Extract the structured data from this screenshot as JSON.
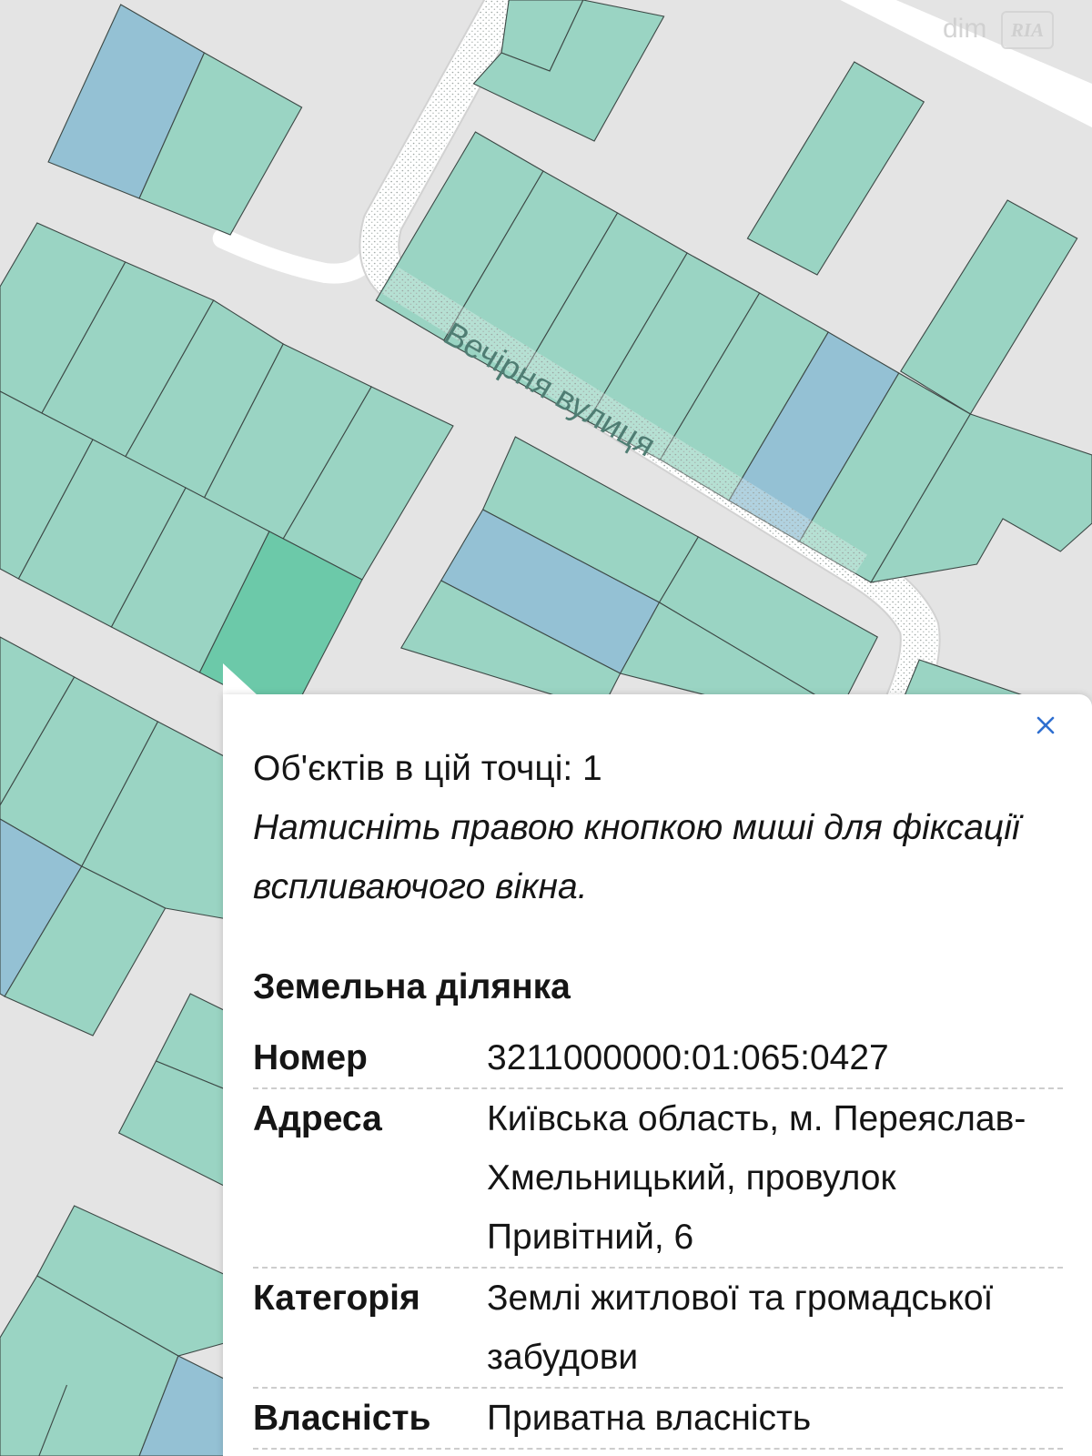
{
  "map": {
    "street_label": "Вечірня вулиця",
    "colors": {
      "background": "#e4e4e4",
      "parcel": "#9ad4c3",
      "parcel_blue": "#94c1d4",
      "parcel_selected": "#6cc9a9",
      "road": "#ffffff",
      "street_label": "#4f7d73"
    }
  },
  "watermark": {
    "site_text": "dim",
    "logo_text": "RIA"
  },
  "popup": {
    "close_icon": "close-icon",
    "close_icon_color": "#2f6fd0",
    "objects_count_text": "Об'єктів в цій точці: 1",
    "hint_text": "Натисніть правою кнопкою миші для фіксації вспливаючого вікна.",
    "section_title": "Земельна ділянка",
    "rows": [
      {
        "label": "Номер",
        "value": "3211000000:01:065:0427"
      },
      {
        "label": "Адреса",
        "value": "Київська область, м. Переяслав-Хмельницький, провулок Привітний, 6"
      },
      {
        "label": "Категорія",
        "value": "Землі житлової та громадської забудови"
      },
      {
        "label": "Власність",
        "value": "Приватна власність"
      }
    ]
  }
}
